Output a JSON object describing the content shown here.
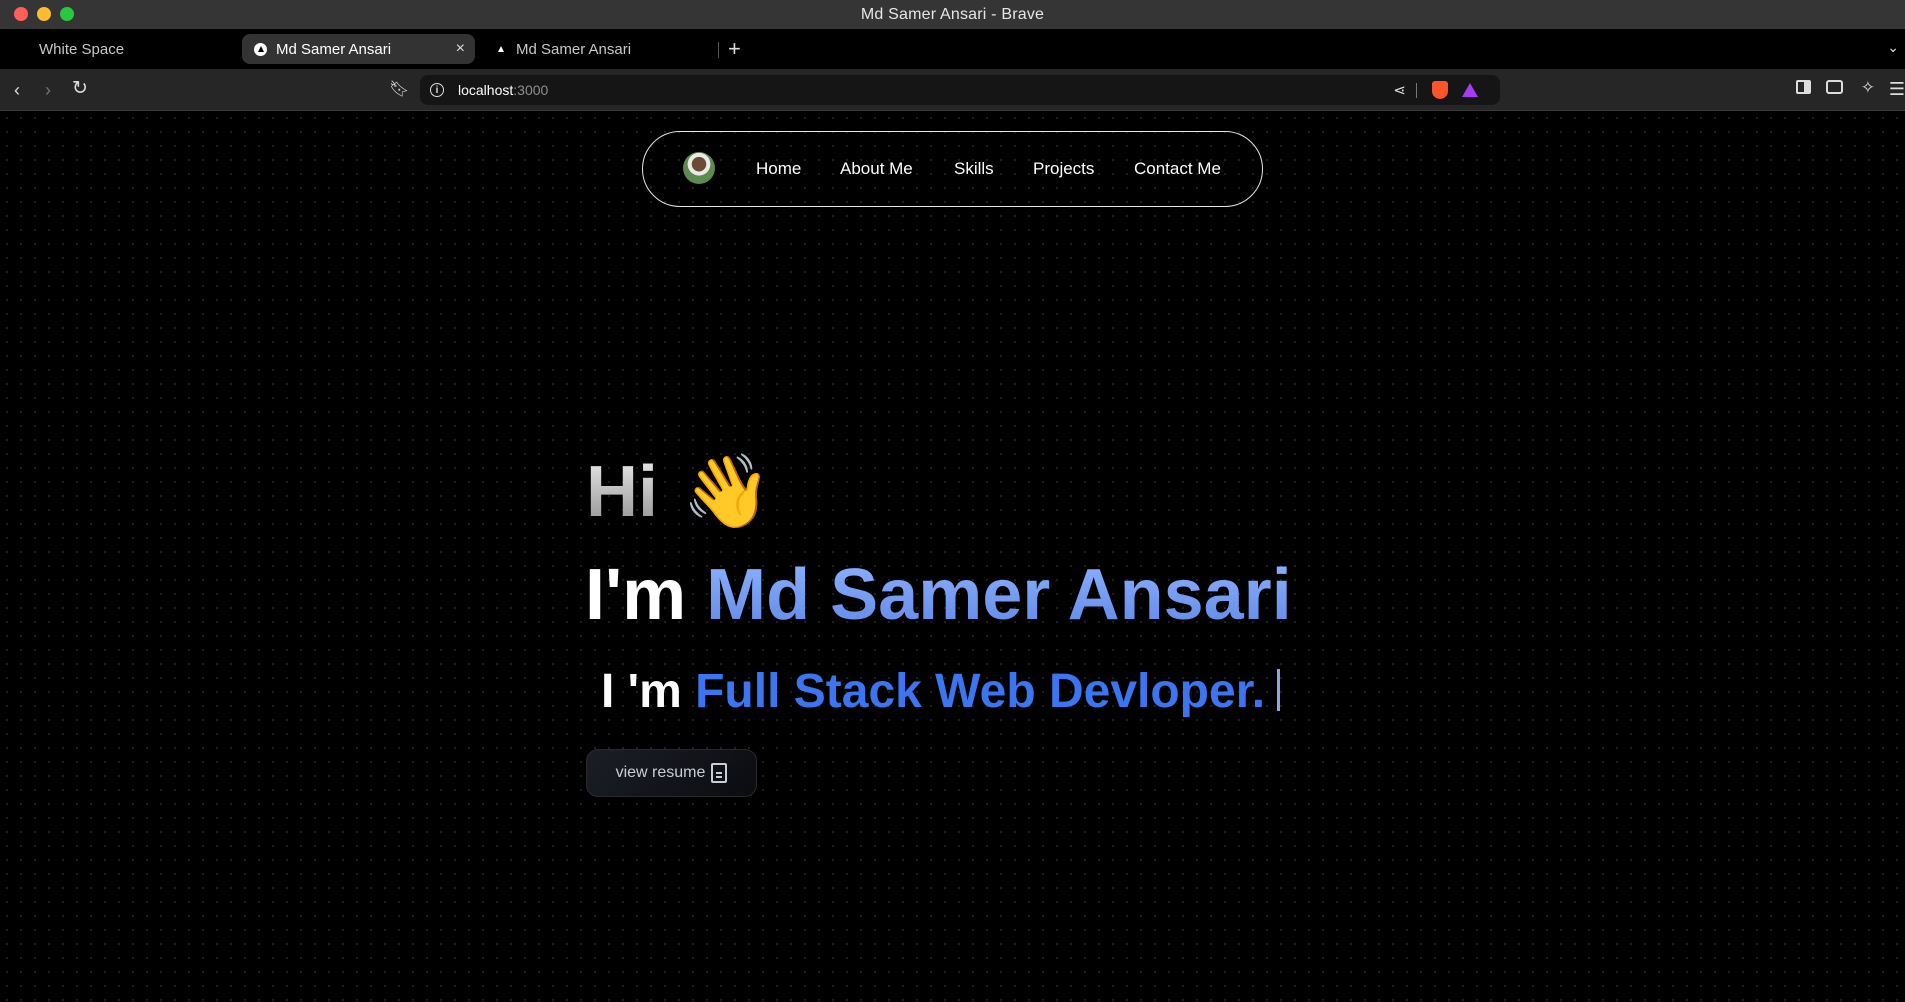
{
  "window": {
    "title": "Md Samer Ansari - Brave"
  },
  "tabs": [
    {
      "label": "White Space",
      "active": false
    },
    {
      "label": "Md Samer Ansari",
      "active": true
    },
    {
      "label": "Md Samer Ansari",
      "active": false
    }
  ],
  "toolbar": {
    "url_host": "localhost",
    "url_port": ":3000"
  },
  "nav": {
    "links": [
      "Home",
      "About Me",
      "Skills",
      "Projects",
      "Contact Me"
    ]
  },
  "hero": {
    "greeting": "Hi",
    "wave": "👋",
    "intro_prefix": "I'm",
    "name": "Md Samer Ansari",
    "role_prefix": "I 'm",
    "role": "Full Stack Web Devloper.",
    "resume_button": "view resume"
  },
  "colors": {
    "accent_blue": "#3b76f0",
    "name_gradient_top": "#8fb3ff",
    "brave_orange": "#fb542b",
    "rewards_purple": "#a43cf0"
  }
}
